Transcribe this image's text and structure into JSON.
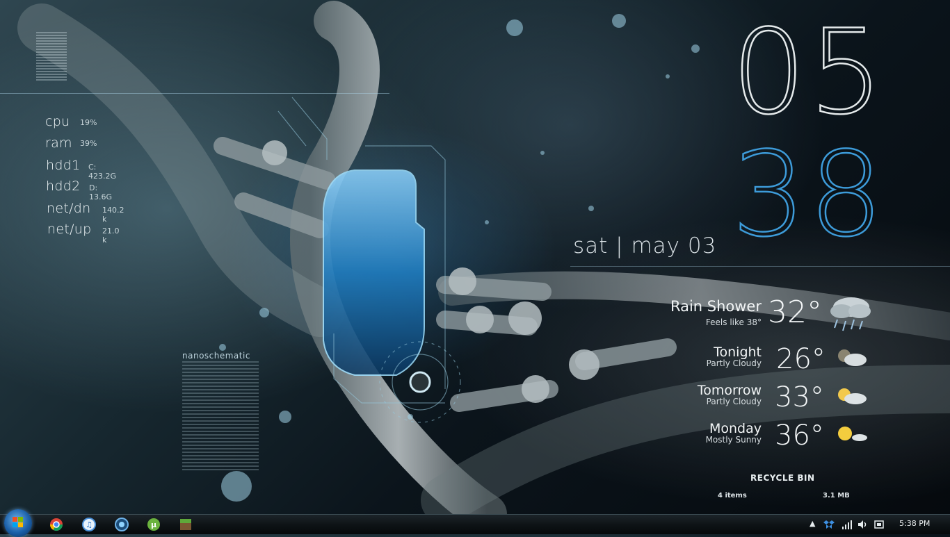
{
  "system_monitor": {
    "items": [
      {
        "label": "cpu",
        "value": "19%"
      },
      {
        "label": "ram",
        "value": "39%"
      },
      {
        "label": "hdd1",
        "value": "C: 423.2G"
      },
      {
        "label": "hdd2",
        "value": "D: 13.6G"
      },
      {
        "label": "net/dn",
        "value": "140.2 k"
      },
      {
        "label": "net/up",
        "value": "21.0 k"
      }
    ]
  },
  "clock": {
    "hour": "05",
    "minute": "38",
    "date": "sat | may 03",
    "hour_color": "#e4e9ea",
    "minute_color": "#3d9bd9"
  },
  "weather": {
    "current": {
      "condition": "Rain Shower",
      "feels_like": "Feels like 38°",
      "temp": "32°",
      "icon": "rain-cloud-icon"
    },
    "forecast": [
      {
        "period": "Tonight",
        "condition": "Partly Cloudy",
        "temp": "26°",
        "icon": "partly-cloudy-night-icon"
      },
      {
        "period": "Tomorrow",
        "condition": "Partly Cloudy",
        "temp": "33°",
        "icon": "partly-cloudy-day-icon"
      },
      {
        "period": "Monday",
        "condition": "Mostly Sunny",
        "temp": "36°",
        "icon": "mostly-sunny-icon"
      }
    ]
  },
  "recycle_bin": {
    "title": "RECYCLE BIN",
    "items": "4 items",
    "size": "3.1 MB"
  },
  "wallpaper": {
    "label": "nanoschematic"
  },
  "taskbar": {
    "pinned": [
      "chrome-icon",
      "itunes-icon",
      "media-center-icon",
      "utorrent-icon",
      "minecraft-icon"
    ],
    "tray_icons": [
      "show-hidden-icons-arrow",
      "dropbox-icon",
      "network-signal-icon",
      "volume-icon",
      "action-center-icon"
    ],
    "time": "5:38 PM"
  }
}
